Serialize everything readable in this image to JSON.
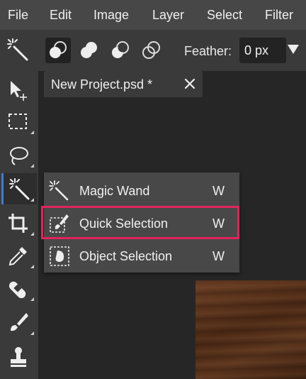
{
  "menubar": {
    "items": [
      {
        "label": "File"
      },
      {
        "label": "Edit"
      },
      {
        "label": "Image"
      },
      {
        "label": "Layer"
      },
      {
        "label": "Select"
      },
      {
        "label": "Filter"
      }
    ]
  },
  "options": {
    "active_tool_icon": "magic-wand-icon",
    "selection_modes": [
      "new-selection-icon",
      "add-selection-icon",
      "subtract-selection-icon",
      "intersect-selection-icon"
    ],
    "feather_label": "Feather:",
    "feather_value": "0 px"
  },
  "tools": [
    {
      "icon": "move-icon"
    },
    {
      "icon": "marquee-icon"
    },
    {
      "icon": "lasso-icon"
    },
    {
      "icon": "magic-wand-icon",
      "active": true
    },
    {
      "icon": "crop-icon"
    },
    {
      "icon": "eyedropper-icon"
    },
    {
      "icon": "healing-icon"
    },
    {
      "icon": "brush-icon"
    },
    {
      "icon": "stamp-icon"
    }
  ],
  "document": {
    "tab_title": "New Project.psd *"
  },
  "flyout": {
    "items": [
      {
        "icon": "magic-wand-icon",
        "label": "Magic Wand",
        "shortcut": "W"
      },
      {
        "icon": "quick-selection-icon",
        "label": "Quick Selection",
        "shortcut": "W",
        "highlighted": true
      },
      {
        "icon": "object-selection-icon",
        "label": "Object Selection",
        "shortcut": "W"
      }
    ]
  },
  "colors": {
    "accent": "#3c7bd6",
    "highlight": "#e0245e",
    "canvas": "#5b341c"
  }
}
